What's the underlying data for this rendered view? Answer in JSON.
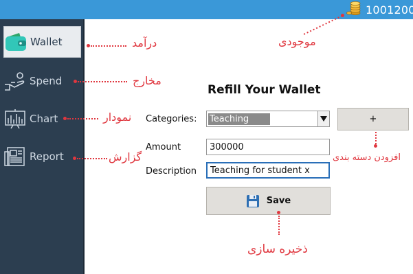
{
  "header": {
    "balance": "1001200"
  },
  "sidebar": {
    "items": [
      {
        "label": "Wallet"
      },
      {
        "label": "Spend"
      },
      {
        "label": "Chart"
      },
      {
        "label": "Report"
      }
    ]
  },
  "annotations": {
    "income": "درآمد",
    "expenses": "مخارج",
    "chart": "نمودار",
    "report": "گزارش",
    "balance": "موجودی",
    "add_category": "افزودن دسته بندی",
    "save": "ذخیره سازی"
  },
  "form": {
    "title": "Refill Your Wallet",
    "categories_label": "Categories:",
    "category_value": "Teaching",
    "add_button": "+",
    "amount_label": "Amount",
    "amount_value": "300000",
    "description_label": "Description",
    "description_value": "Teaching for student x",
    "save_button": "Save"
  },
  "colors": {
    "topbar": "#3a98d8",
    "sidebar": "#2c3e50",
    "annotation": "#e0373f"
  },
  "icons": [
    "coins-icon",
    "wallet-icon",
    "spend-hand-icon",
    "chart-icon",
    "report-icon",
    "save-disk-icon",
    "dropdown-arrow-icon"
  ]
}
